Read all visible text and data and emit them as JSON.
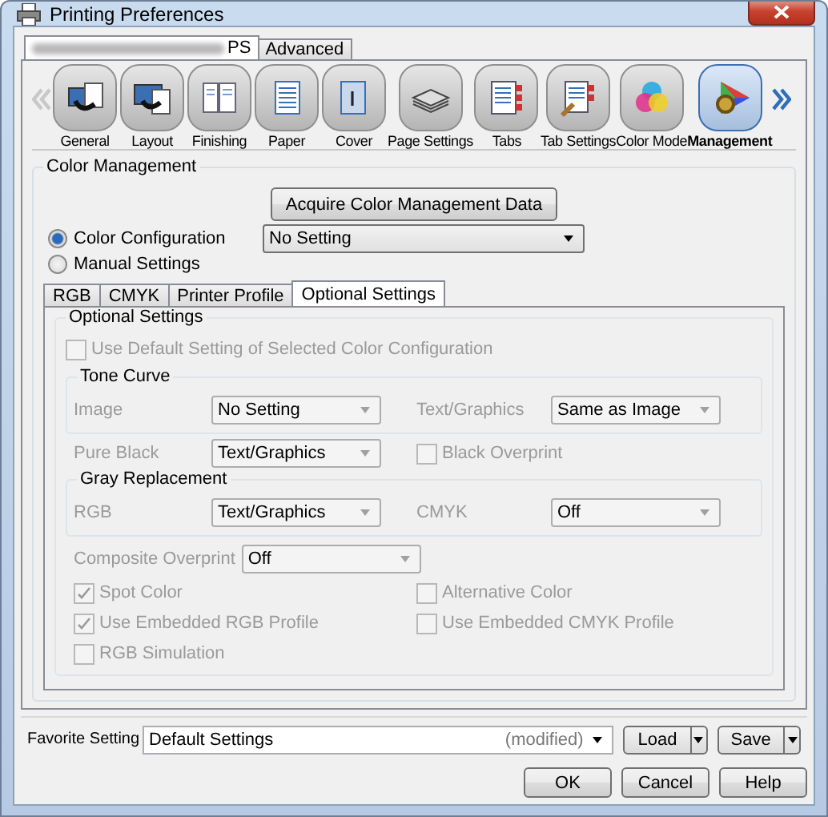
{
  "window": {
    "title": "Printing Preferences"
  },
  "top_tabs": [
    {
      "label": "PS",
      "selected": true,
      "blurred_prefix": true
    },
    {
      "label": "Advanced",
      "selected": false
    }
  ],
  "toolbar": [
    {
      "label": "General",
      "selected": false
    },
    {
      "label": "Layout",
      "selected": false
    },
    {
      "label": "Finishing",
      "selected": false
    },
    {
      "label": "Paper",
      "selected": false
    },
    {
      "label": "Cover",
      "selected": false
    },
    {
      "label": "Page Settings",
      "selected": false
    },
    {
      "label": "Tabs",
      "selected": false
    },
    {
      "label": "Tab Settings",
      "selected": false
    },
    {
      "label": "Color Mode",
      "selected": false
    },
    {
      "label": "Management",
      "selected": true
    }
  ],
  "color_management": {
    "title": "Color Management",
    "acquire_button": "Acquire Color Management Data",
    "configuration_value": "No Setting",
    "options": [
      {
        "label": "Color Configuration",
        "selected": true
      },
      {
        "label": "Manual Settings",
        "selected": false
      }
    ],
    "tabs": [
      {
        "label": "RGB",
        "selected": false
      },
      {
        "label": "CMYK",
        "selected": false
      },
      {
        "label": "Printer Profile",
        "selected": false
      },
      {
        "label": "Optional Settings",
        "selected": true
      }
    ],
    "optional": {
      "title": "Optional Settings",
      "disabled": true,
      "use_default": {
        "label": "Use Default Setting of Selected Color Configuration",
        "checked": false
      },
      "tone_curve": {
        "title": "Tone Curve",
        "fields": [
          {
            "label": "Image",
            "value": "No Setting"
          },
          {
            "label": "Text/Graphics",
            "value": "Same as Image"
          }
        ]
      },
      "pure_black": {
        "label": "Pure Black",
        "value": "Text/Graphics"
      },
      "black_overprint": {
        "label": "Black Overprint",
        "checked": false
      },
      "gray_replacement": {
        "title": "Gray Replacement",
        "fields": [
          {
            "label": "RGB",
            "value": "Text/Graphics"
          },
          {
            "label": "CMYK",
            "value": "Off"
          }
        ]
      },
      "composite_overprint": {
        "label": "Composite Overprint",
        "value": "Off"
      },
      "checkboxes": [
        {
          "label": "Spot Color",
          "checked": true
        },
        {
          "label": "Alternative Color",
          "checked": false
        },
        {
          "label": "Use Embedded RGB Profile",
          "checked": true
        },
        {
          "label": "Use Embedded CMYK Profile",
          "checked": false
        },
        {
          "label": "RGB Simulation",
          "checked": false
        }
      ]
    }
  },
  "favorite": {
    "label": "Favorite Setting",
    "value": "Default Settings",
    "note": "(modified)",
    "buttons": [
      "Load",
      "Save"
    ]
  },
  "buttons": [
    "OK",
    "Cancel",
    "Help"
  ]
}
